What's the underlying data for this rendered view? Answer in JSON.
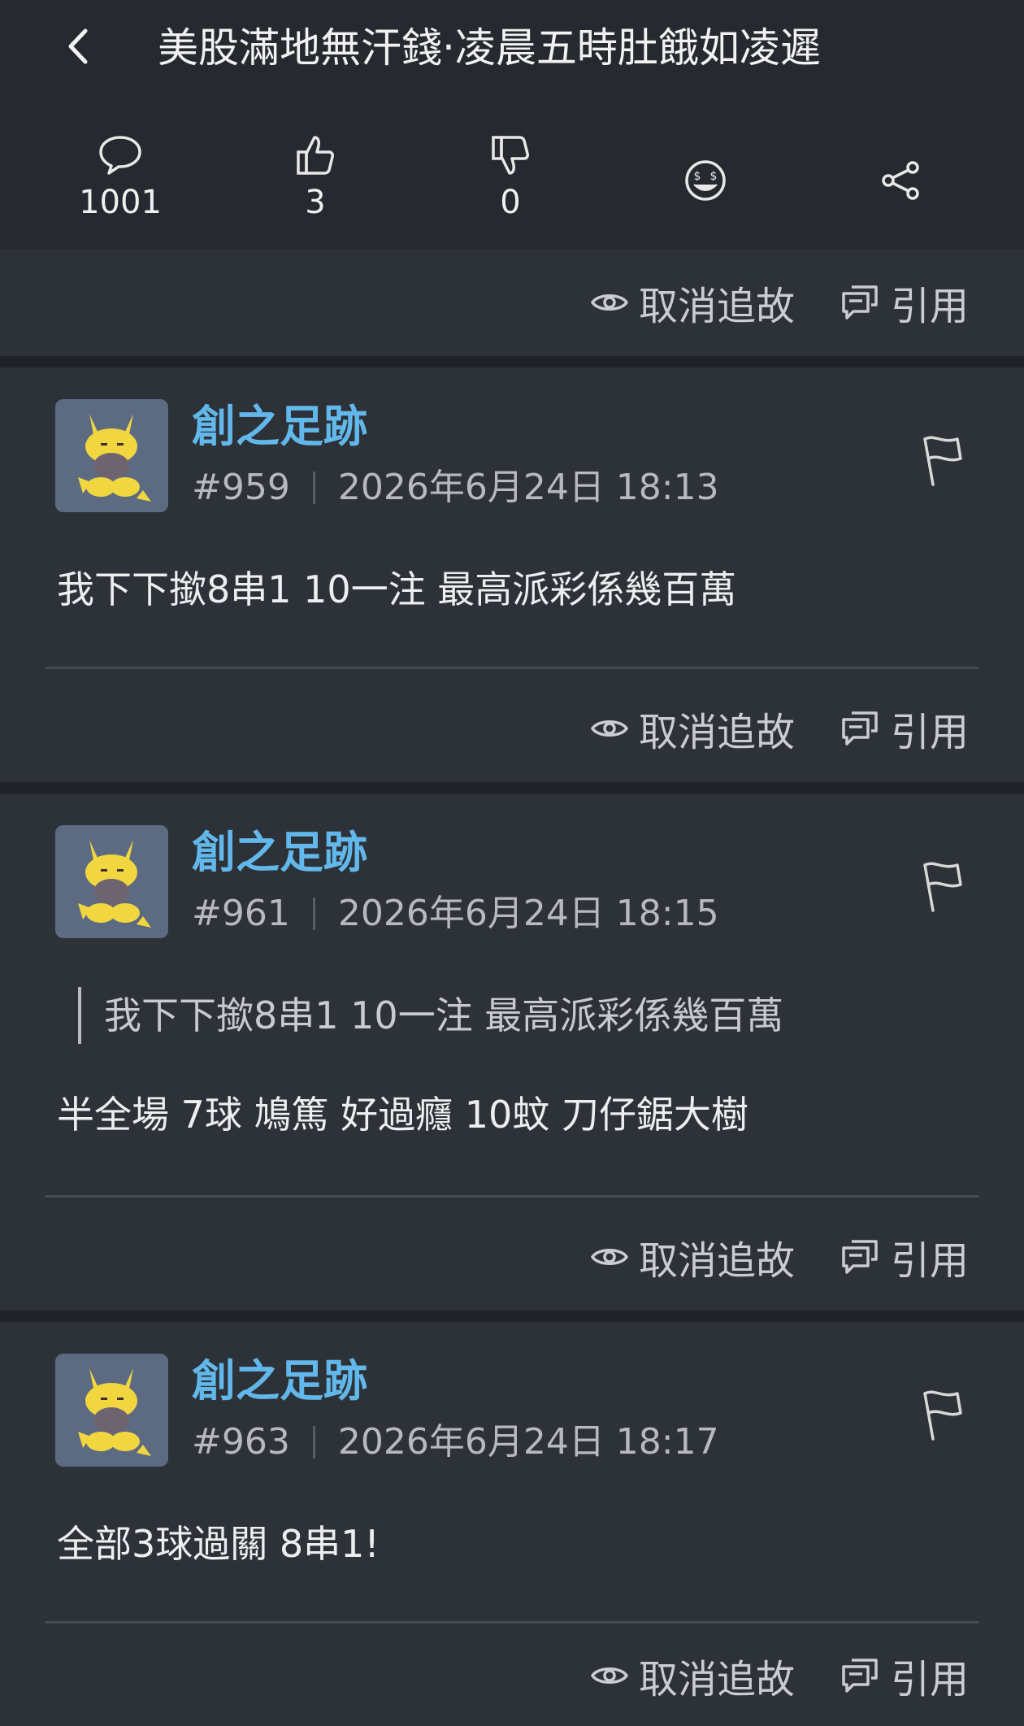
{
  "header": {
    "title": "美股滿地無汗錢‧凌晨五時肚餓如凌遲",
    "stats": {
      "replies": "1001",
      "likes": "3",
      "dislikes": "0"
    }
  },
  "actions": {
    "unfollow_label": "取消追故",
    "quote_label": "引用"
  },
  "posts": [
    {
      "username": "創之足跡",
      "number": "#959",
      "timestamp": "2026年6月24日 18:13",
      "quote": "",
      "body": "我下下撳8串1 10一注 最高派彩係幾百萬"
    },
    {
      "username": "創之足跡",
      "number": "#961",
      "timestamp": "2026年6月24日 18:15",
      "quote": "我下下撳8串1 10一注 最高派彩係幾百萬",
      "body": "半全場 7球 鳩篤 好過癮 10蚊 刀仔鋸大樹"
    },
    {
      "username": "創之足跡",
      "number": "#963",
      "timestamp": "2026年6月24日 18:17",
      "quote": "",
      "body": "全部3球過關 8串1!"
    }
  ],
  "colors": {
    "background": "#2d3239",
    "header": "#262a30",
    "username": "#62b8ea",
    "separator": "#1f2227"
  },
  "icons": [
    "back-icon",
    "comment-icon",
    "thumbs-up-icon",
    "thumbs-down-icon",
    "emoji-icon",
    "share-icon",
    "eye-icon",
    "quote-icon",
    "flag-icon"
  ]
}
